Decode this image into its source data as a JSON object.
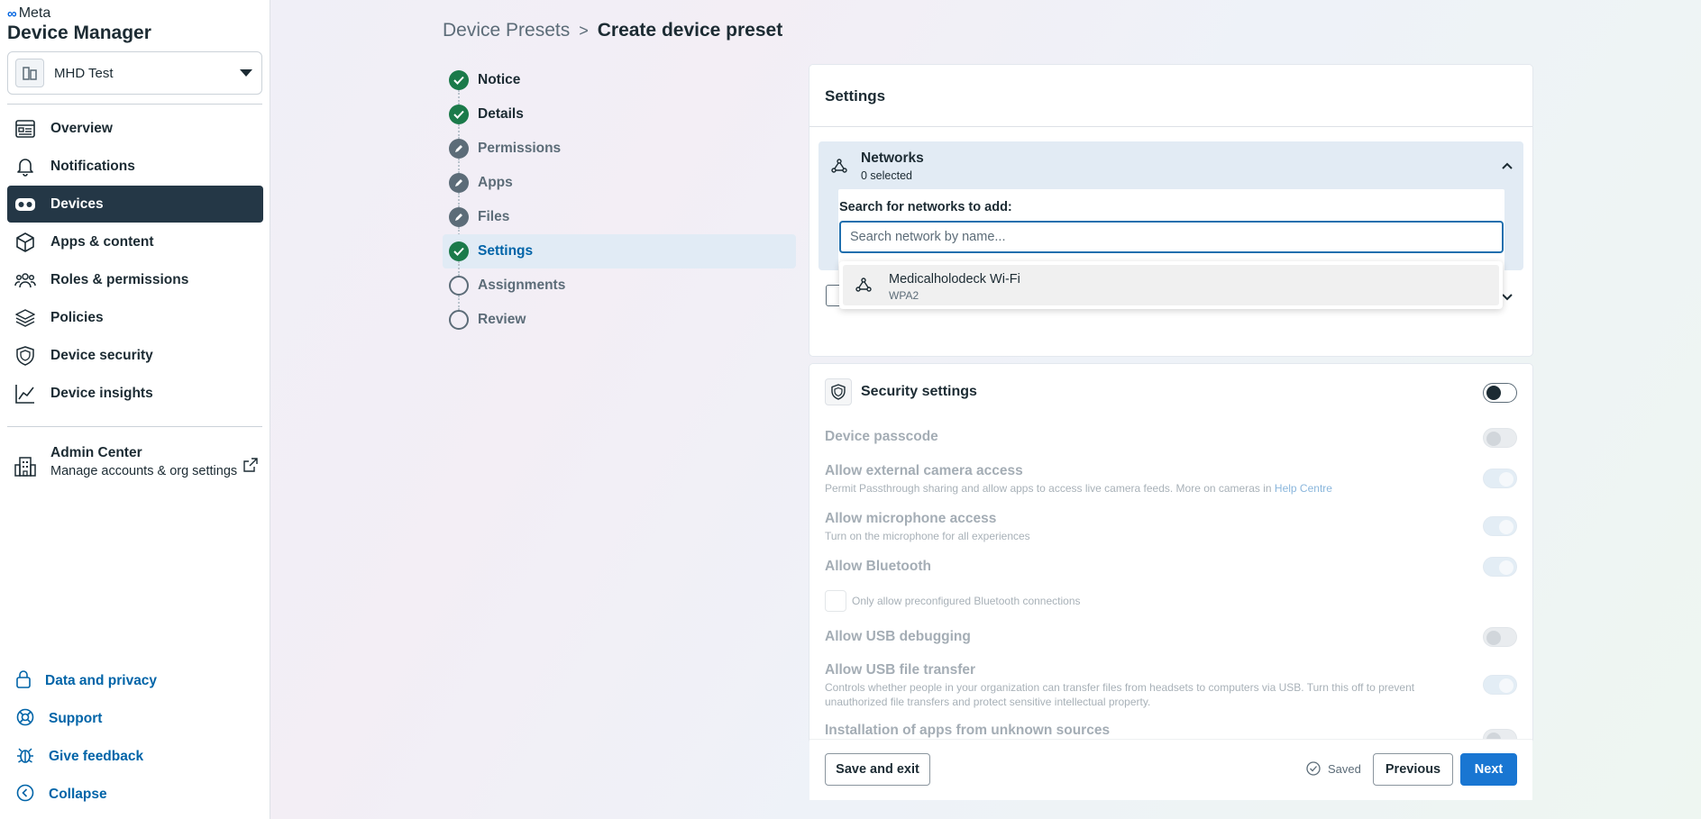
{
  "brand": {
    "meta_label": "Meta",
    "app_title": "Device Manager"
  },
  "org": {
    "name": "MHD Test"
  },
  "nav": {
    "items": [
      {
        "label": "Overview"
      },
      {
        "label": "Notifications"
      },
      {
        "label": "Devices"
      },
      {
        "label": "Apps & content"
      },
      {
        "label": "Roles & permissions"
      },
      {
        "label": "Policies"
      },
      {
        "label": "Device security"
      },
      {
        "label": "Device insights"
      }
    ],
    "active": "Devices"
  },
  "admin": {
    "title": "Admin Center",
    "subtitle": "Manage accounts & org settings"
  },
  "bottom_links": [
    {
      "label": "Data and privacy"
    },
    {
      "label": "Support"
    },
    {
      "label": "Give feedback"
    },
    {
      "label": "Collapse"
    }
  ],
  "breadcrumb": {
    "parent": "Device Presets",
    "separator": ">",
    "current": "Create device preset"
  },
  "steps": [
    {
      "label": "Notice",
      "status": "done"
    },
    {
      "label": "Details",
      "status": "done"
    },
    {
      "label": "Permissions",
      "status": "edit"
    },
    {
      "label": "Apps",
      "status": "edit"
    },
    {
      "label": "Files",
      "status": "edit"
    },
    {
      "label": "Settings",
      "status": "current"
    },
    {
      "label": "Assignments",
      "status": "pending"
    },
    {
      "label": "Review",
      "status": "pending"
    }
  ],
  "settings": {
    "title": "Settings",
    "networks": {
      "title": "Networks",
      "count": "0 selected",
      "search_label": "Search for networks to add:",
      "search_placeholder": "Search network by name...",
      "search_value": ""
    },
    "dropdown": {
      "options": [
        {
          "name": "Medicalholodeck Wi-Fi",
          "security": "WPA2"
        }
      ]
    }
  },
  "security": {
    "title": "Security settings",
    "enabled": false,
    "items": {
      "device_passcode": {
        "title": "Device passcode"
      },
      "external_camera": {
        "title": "Allow external camera access",
        "desc": "Permit Passthrough sharing and allow apps to access live camera feeds. More on cameras in",
        "link": "Help Centre"
      },
      "microphone": {
        "title": "Allow microphone access",
        "desc": "Turn on the microphone for all experiences"
      },
      "bluetooth": {
        "title": "Allow Bluetooth",
        "checkbox_label": "Only allow preconfigured Bluetooth connections"
      },
      "usb_debugging": {
        "title": "Allow USB debugging"
      },
      "usb_file_transfer": {
        "title": "Allow USB file transfer",
        "desc": "Controls whether people in your organization can transfer files from headsets to computers via USB. Turn this off to prevent unauthorized file transfers and protect sensitive intellectual property."
      },
      "unknown_sources": {
        "title": "Installation of apps from unknown sources"
      }
    }
  },
  "footer": {
    "save_exit": "Save and exit",
    "saved": "Saved",
    "previous": "Previous",
    "next": "Next"
  },
  "colors": {
    "primary": "#1976d2",
    "nav_active": "#243746",
    "success": "#1b7a4a",
    "link": "#0064a8"
  }
}
